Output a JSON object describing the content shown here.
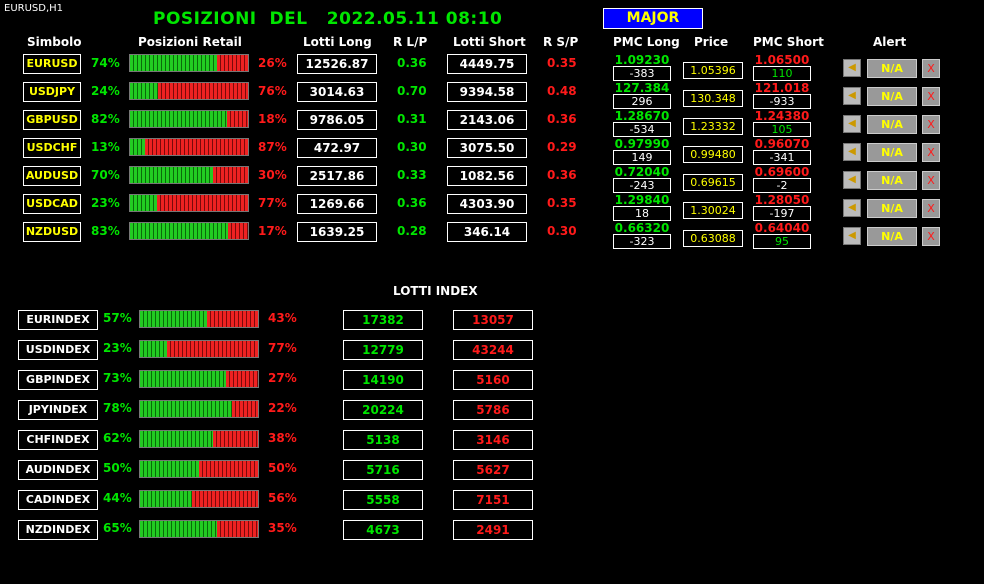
{
  "window_label": "EURUSD,H1",
  "title": "POSIZIONI  DEL   2022.05.11 08:10",
  "major_label": "MAJOR",
  "headers": {
    "simbolo": "Simbolo",
    "posizioni_retail": "Posizioni Retail",
    "lotti_long": "Lotti Long",
    "r_lp": "R L/P",
    "lotti_short": "Lotti Short",
    "r_sp": "R S/P",
    "pmc_long": "PMC Long",
    "price": "Price",
    "pmc_short": "PMC Short",
    "alert": "Alert"
  },
  "colors": {
    "long": "#00e600",
    "short": "#ff1a1a",
    "symbol": "#ffff00",
    "major_bg": "#0000ff"
  },
  "pairs": [
    {
      "symbol": "EURUSD",
      "long_pct": "74%",
      "long_frac": 0.74,
      "short_pct": "26%",
      "lotti_long": "12526.87",
      "r_lp": "0.36",
      "lotti_short": "4449.75",
      "r_sp": "0.35",
      "pmc_long": "1.09230",
      "pmc_long_pips": "-383",
      "price": "1.05396",
      "pmc_short": "1.06500",
      "pmc_short_pips": "110",
      "alert": "N/A",
      "close": "X"
    },
    {
      "symbol": "USDJPY",
      "long_pct": "24%",
      "long_frac": 0.24,
      "short_pct": "76%",
      "lotti_long": "3014.63",
      "r_lp": "0.70",
      "lotti_short": "9394.58",
      "r_sp": "0.48",
      "pmc_long": "127.384",
      "pmc_long_pips": "296",
      "price": "130.348",
      "pmc_short": "121.018",
      "pmc_short_pips": "-933",
      "alert": "N/A",
      "close": "X"
    },
    {
      "symbol": "GBPUSD",
      "long_pct": "82%",
      "long_frac": 0.82,
      "short_pct": "18%",
      "lotti_long": "9786.05",
      "r_lp": "0.31",
      "lotti_short": "2143.06",
      "r_sp": "0.36",
      "pmc_long": "1.28670",
      "pmc_long_pips": "-534",
      "price": "1.23332",
      "pmc_short": "1.24380",
      "pmc_short_pips": "105",
      "alert": "N/A",
      "close": "X"
    },
    {
      "symbol": "USDCHF",
      "long_pct": "13%",
      "long_frac": 0.13,
      "short_pct": "87%",
      "lotti_long": "472.97",
      "r_lp": "0.30",
      "lotti_short": "3075.50",
      "r_sp": "0.29",
      "pmc_long": "0.97990",
      "pmc_long_pips": "149",
      "price": "0.99480",
      "pmc_short": "0.96070",
      "pmc_short_pips": "-341",
      "alert": "N/A",
      "close": "X"
    },
    {
      "symbol": "AUDUSD",
      "long_pct": "70%",
      "long_frac": 0.7,
      "short_pct": "30%",
      "lotti_long": "2517.86",
      "r_lp": "0.33",
      "lotti_short": "1082.56",
      "r_sp": "0.36",
      "pmc_long": "0.72040",
      "pmc_long_pips": "-243",
      "price": "0.69615",
      "pmc_short": "0.69600",
      "pmc_short_pips": "-2",
      "alert": "N/A",
      "close": "X"
    },
    {
      "symbol": "USDCAD",
      "long_pct": "23%",
      "long_frac": 0.23,
      "short_pct": "77%",
      "lotti_long": "1269.66",
      "r_lp": "0.36",
      "lotti_short": "4303.90",
      "r_sp": "0.35",
      "pmc_long": "1.29840",
      "pmc_long_pips": "18",
      "price": "1.30024",
      "pmc_short": "1.28050",
      "pmc_short_pips": "-197",
      "alert": "N/A",
      "close": "X"
    },
    {
      "symbol": "NZDUSD",
      "long_pct": "83%",
      "long_frac": 0.83,
      "short_pct": "17%",
      "lotti_long": "1639.25",
      "r_lp": "0.28",
      "lotti_short": "346.14",
      "r_sp": "0.30",
      "pmc_long": "0.66320",
      "pmc_long_pips": "-323",
      "price": "0.63088",
      "pmc_short": "0.64040",
      "pmc_short_pips": "95",
      "alert": "N/A",
      "close": "X"
    }
  ],
  "lotti_index_title": "LOTTI INDEX",
  "indexes": [
    {
      "name": "EURINDEX",
      "long_pct": "57%",
      "long_frac": 0.57,
      "short_pct": "43%",
      "lotti_long": "17382",
      "lotti_short": "13057"
    },
    {
      "name": "USDINDEX",
      "long_pct": "23%",
      "long_frac": 0.23,
      "short_pct": "77%",
      "lotti_long": "12779",
      "lotti_short": "43244"
    },
    {
      "name": "GBPINDEX",
      "long_pct": "73%",
      "long_frac": 0.73,
      "short_pct": "27%",
      "lotti_long": "14190",
      "lotti_short": "5160"
    },
    {
      "name": "JPYINDEX",
      "long_pct": "78%",
      "long_frac": 0.78,
      "short_pct": "22%",
      "lotti_long": "20224",
      "lotti_short": "5786"
    },
    {
      "name": "CHFINDEX",
      "long_pct": "62%",
      "long_frac": 0.62,
      "short_pct": "38%",
      "lotti_long": "5138",
      "lotti_short": "3146"
    },
    {
      "name": "AUDINDEX",
      "long_pct": "50%",
      "long_frac": 0.5,
      "short_pct": "50%",
      "lotti_long": "5716",
      "lotti_short": "5627"
    },
    {
      "name": "CADINDEX",
      "long_pct": "44%",
      "long_frac": 0.44,
      "short_pct": "56%",
      "lotti_long": "5558",
      "lotti_short": "7151"
    },
    {
      "name": "NZDINDEX",
      "long_pct": "65%",
      "long_frac": 0.65,
      "short_pct": "35%",
      "lotti_long": "4673",
      "lotti_short": "2491"
    }
  ]
}
